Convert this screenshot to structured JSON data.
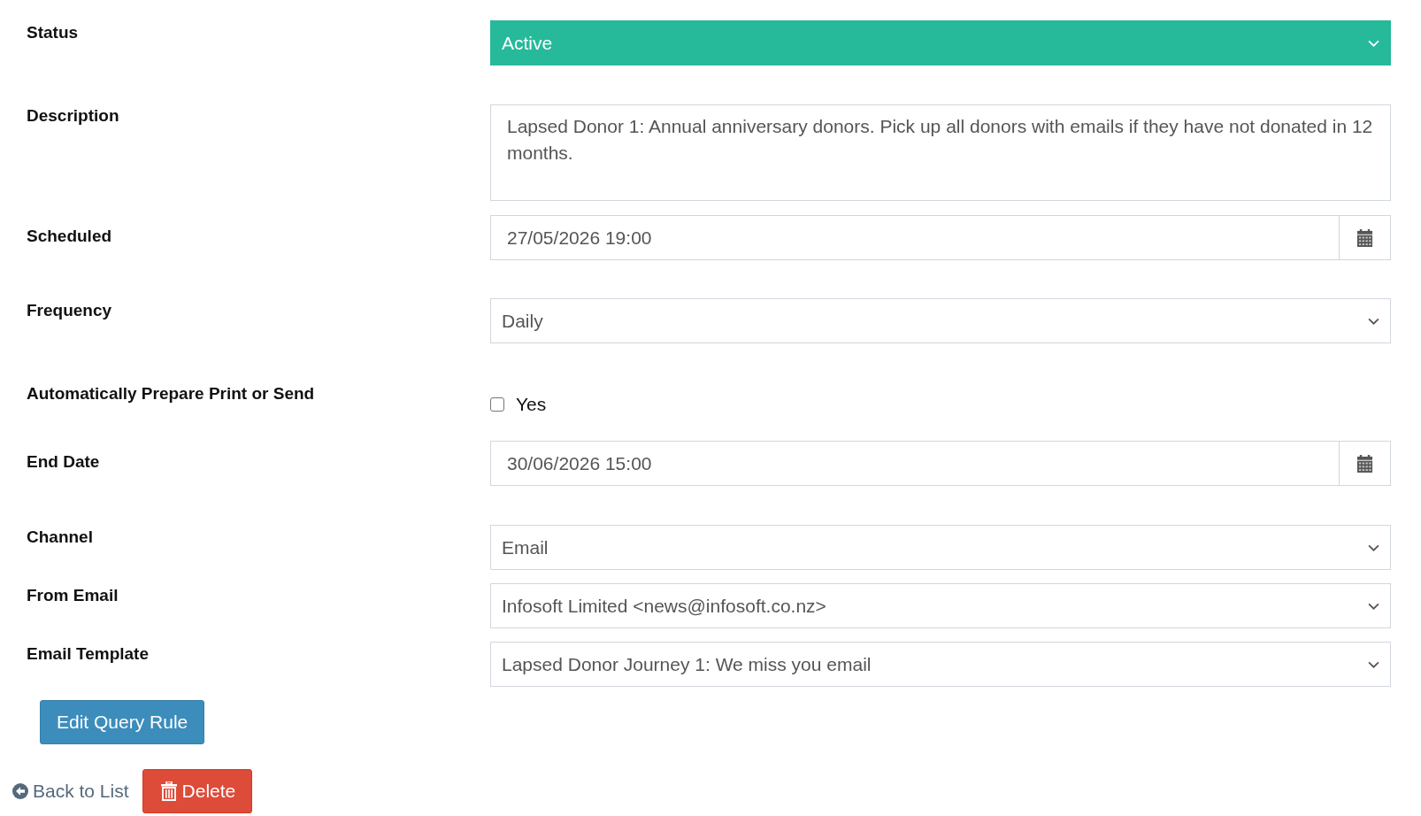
{
  "fields": [
    {
      "label": "Status",
      "kind": "select",
      "value": "Active",
      "color": "#26b99a"
    },
    {
      "label": "Description",
      "kind": "textarea",
      "value": "Lapsed Donor 1: Annual anniversary donors. Pick up all donors with emails if they have not donated in 12 months."
    },
    {
      "label": "Scheduled",
      "kind": "datetime",
      "value": "27/05/2026 19:00"
    },
    {
      "label": "Frequency",
      "kind": "select",
      "value": "Daily"
    },
    {
      "label": "Automatically Prepare Print or Send",
      "kind": "checkbox",
      "option": "Yes",
      "checked": false
    },
    {
      "label": "End Date",
      "kind": "datetime",
      "value": "30/06/2026 15:00"
    },
    {
      "label": "Channel",
      "kind": "select",
      "value": "Email"
    },
    {
      "label": "From Email",
      "kind": "select",
      "value": "Infosoft Limited <news@infosoft.co.nz>"
    },
    {
      "label": "Email Template",
      "kind": "select",
      "value": "Lapsed Donor Journey 1: We miss you email"
    }
  ],
  "edit_button": {
    "label": "Edit Query Rule"
  },
  "back_link": {
    "label": "Back to List"
  },
  "delete_button": {
    "label": "Delete"
  }
}
